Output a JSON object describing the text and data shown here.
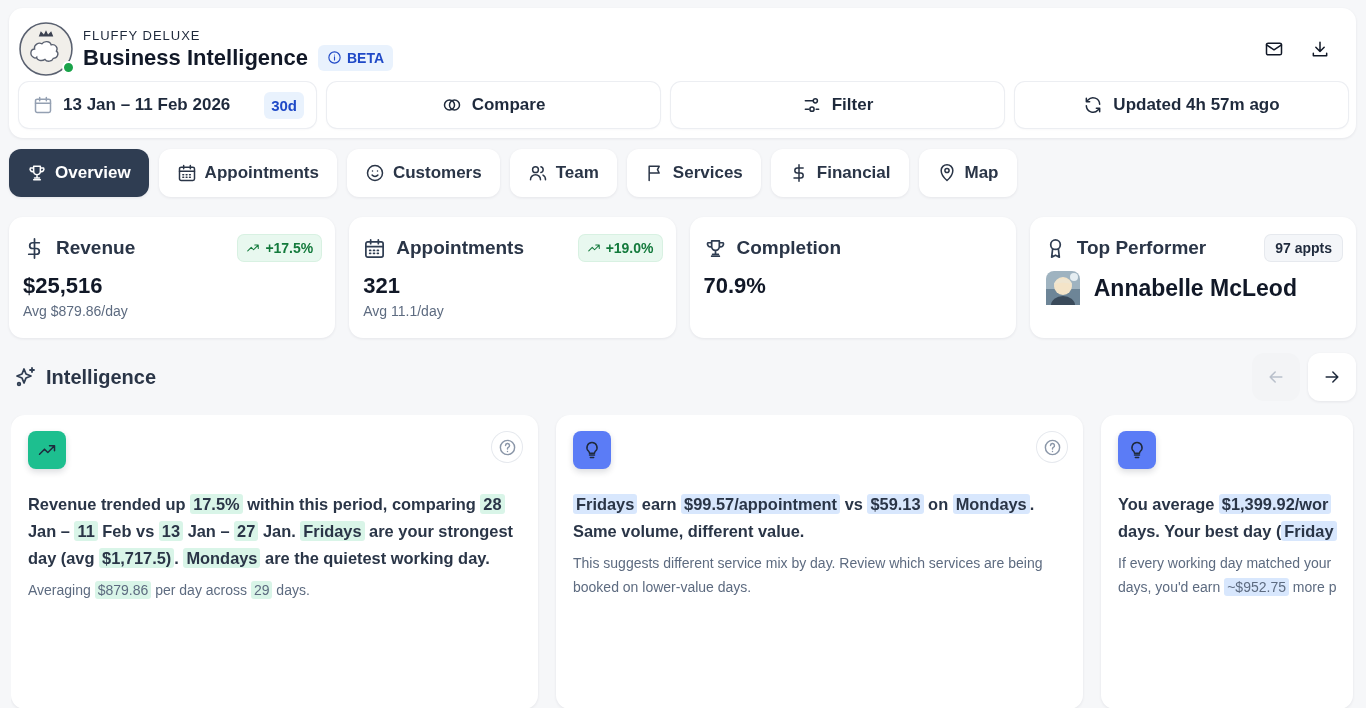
{
  "header": {
    "brand": "FLUFFY DELUXE",
    "title": "Business Intelligence",
    "badge": "BETA",
    "online": true,
    "date_range": {
      "label": "13 Jan – 11 Feb 2026",
      "days": "30d"
    },
    "actions": [
      {
        "label": "Compare"
      },
      {
        "label": "Filter"
      },
      {
        "label": "Updated 4h 57m ago"
      }
    ]
  },
  "tabs": [
    {
      "label": "Overview",
      "selected": true
    },
    {
      "label": "Appointments",
      "selected": false
    },
    {
      "label": "Customers",
      "selected": false
    },
    {
      "label": "Team",
      "selected": false
    },
    {
      "label": "Services",
      "selected": false
    },
    {
      "label": "Financial",
      "selected": false
    },
    {
      "label": "Map",
      "selected": false
    }
  ],
  "stats": [
    {
      "kind": "revenue",
      "title": "Revenue",
      "change": "+17.5%",
      "value": "$25,516",
      "sub": "Avg $879.86/day"
    },
    {
      "kind": "appointments",
      "title": "Appointments",
      "change": "+19.0%",
      "value": "321",
      "sub": "Avg 11.1/day"
    },
    {
      "kind": "completion",
      "title": "Completion",
      "value": "70.9%"
    },
    {
      "kind": "performer",
      "title": "Top Performer",
      "badge": "97 appts",
      "value": "Annabelle McLeod"
    }
  ],
  "intelligence": {
    "title": "Intelligence",
    "prev_disabled": true,
    "next_disabled": false,
    "cards": [
      {
        "kind": "trend",
        "color": "#1dbf8f",
        "help": true,
        "text": [
          {
            "text": "Revenue trended up ",
            "highlight": false
          },
          {
            "text": "17.5%",
            "highlight": true
          },
          {
            "text": " within this period, comparing ",
            "highlight": false
          },
          {
            "text": "28",
            "highlight": true
          },
          {
            "text": " Jan – ",
            "highlight": false
          },
          {
            "text": "11",
            "highlight": true
          },
          {
            "text": " Feb vs ",
            "highlight": false
          },
          {
            "text": "13",
            "highlight": true
          },
          {
            "text": " Jan – ",
            "highlight": false
          },
          {
            "text": "27",
            "highlight": true
          },
          {
            "text": " Jan. ",
            "highlight": false
          },
          {
            "text": "Fridays",
            "highlight": true
          },
          {
            "text": " are your strongest day (avg ",
            "highlight": false
          },
          {
            "text": "$1,717.5)",
            "highlight": true
          },
          {
            "text": ". ",
            "highlight": false
          },
          {
            "text": "Mondays",
            "highlight": true
          },
          {
            "text": " are the quietest working day.",
            "highlight": false
          }
        ],
        "note": [
          {
            "text": "Averaging ",
            "highlight": false
          },
          {
            "text": "$879.86",
            "highlight": true
          },
          {
            "text": " per day across ",
            "highlight": false
          },
          {
            "text": "29",
            "highlight": true
          },
          {
            "text": " days.",
            "highlight": false
          }
        ]
      },
      {
        "kind": "idea",
        "color": "#5b7cf6",
        "help": true,
        "text": [
          {
            "text": "Fridays",
            "highlight": true
          },
          {
            "text": " earn ",
            "highlight": false
          },
          {
            "text": "$99.57/appointment",
            "highlight": true
          },
          {
            "text": " vs ",
            "highlight": false
          },
          {
            "text": "$59.13",
            "highlight": true
          },
          {
            "text": " on ",
            "highlight": false
          },
          {
            "text": "Mondays",
            "highlight": true
          },
          {
            "text": ". Same volume, different value.",
            "highlight": false
          }
        ],
        "note": [
          {
            "text": "This suggests different service mix by day. Review which services are being booked on lower-value days.",
            "highlight": false
          }
        ]
      },
      {
        "kind": "idea",
        "color": "#5b7cf6",
        "help": false,
        "text": [
          {
            "text": "You average ",
            "highlight": false
          },
          {
            "text": "$1,399.92/wor",
            "highlight": true
          },
          {
            "text": " days. Your best day (",
            "highlight": false
          },
          {
            "text": "Friday",
            "highlight": true
          }
        ],
        "note": [
          {
            "text": "If every working day matched your ",
            "highlight": false
          },
          {
            "text": "days, you'd earn ",
            "highlight": false
          },
          {
            "text": "~$952.75",
            "highlight": true
          },
          {
            "text": " more p",
            "highlight": false
          }
        ]
      }
    ]
  }
}
